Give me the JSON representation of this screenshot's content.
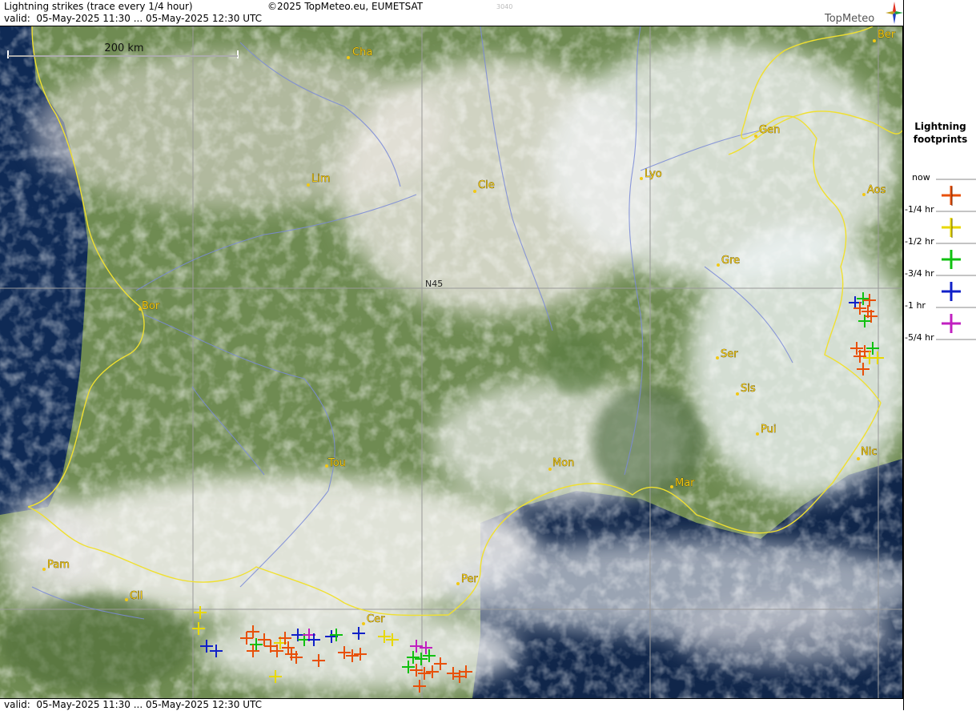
{
  "header": {
    "title": "Lightning strikes (trace every 1/4 hour)",
    "copyright": "©2025 TopMeteo.eu, EUMETSAT",
    "code": "3040",
    "valid": "valid:  05-May-2025 11:30 ... 05-May-2025 12:30 UTC"
  },
  "footer": {
    "valid": "valid:  05-May-2025 11:30 ... 05-May-2025 12:30 UTC"
  },
  "logo": {
    "text": "TopMeteo",
    "icon": "compass-star-icon"
  },
  "map": {
    "scale_label": "200 km",
    "grid_label": "N45",
    "cities": [
      "Cha",
      "Ber",
      "Gen",
      "Lim",
      "Cle",
      "Lyo",
      "Aos",
      "Gre",
      "Bor",
      "Ser",
      "Sis",
      "Pui",
      "Tou",
      "Mon",
      "Nic",
      "Mar",
      "Pam",
      "Cil",
      "Per",
      "Cer"
    ]
  },
  "legend": {
    "title": "Lightning\nfootprints",
    "items": [
      {
        "label": "now",
        "color": "#e8500a"
      },
      {
        "label": "-1/4 hr",
        "color": "#e8d800"
      },
      {
        "label": "-1/2 hr",
        "color": "#10c010"
      },
      {
        "label": "-3/4 hr",
        "color": "#1020c8"
      },
      {
        "label": "-1 hr",
        "color": "#c020c0"
      },
      {
        "label": "-5/4 hr",
        "color": ""
      }
    ]
  },
  "colors": {
    "sea": "#0f2a55",
    "land": "#6f8b52",
    "border": "#f0e030",
    "river": "#7a8ad8",
    "grid": "#9a9a9a",
    "city": "#f2c814"
  }
}
